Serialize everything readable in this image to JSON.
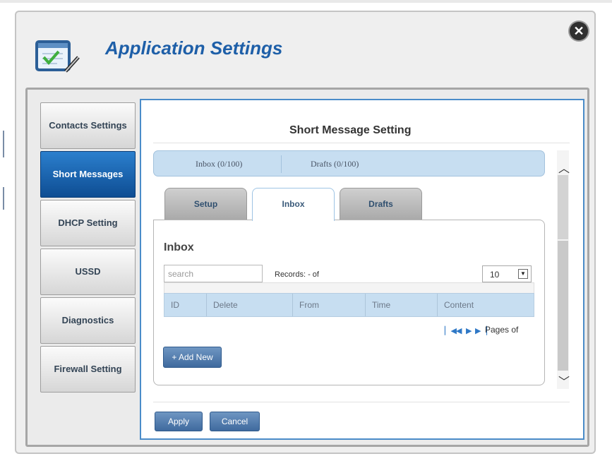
{
  "header": {
    "title": "Application Settings",
    "icon": "settings-checklist-icon",
    "close_icon": "close-icon"
  },
  "sidebar": {
    "items": [
      {
        "label": "Contacts Settings",
        "active": false
      },
      {
        "label": "Short Messages",
        "active": true
      },
      {
        "label": "DHCP Setting",
        "active": false
      },
      {
        "label": "USSD",
        "active": false
      },
      {
        "label": "Diagnostics",
        "active": false
      },
      {
        "label": "Firewall Setting",
        "active": false
      }
    ]
  },
  "panel": {
    "title": "Short Message Setting",
    "summary": {
      "inbox": "Inbox (0/100)",
      "drafts": "Drafts (0/100)"
    },
    "tabs": [
      {
        "label": "Setup",
        "active": false
      },
      {
        "label": "Inbox",
        "active": true
      },
      {
        "label": "Drafts",
        "active": false
      }
    ],
    "inbox": {
      "heading": "Inbox",
      "search_placeholder": "search",
      "records_label": "Records: - of",
      "page_size": "10",
      "columns": [
        "ID",
        "Delete",
        "From",
        "Time",
        "Content"
      ],
      "pages_label": "Pages of",
      "add_new": "+ Add New"
    }
  },
  "footer": {
    "apply": "Apply",
    "cancel": "Cancel"
  },
  "colors": {
    "accent": "#1e5fa8",
    "active_nav": "#1a60aa",
    "table_header": "#c7def1",
    "button": "#4f78aa"
  }
}
